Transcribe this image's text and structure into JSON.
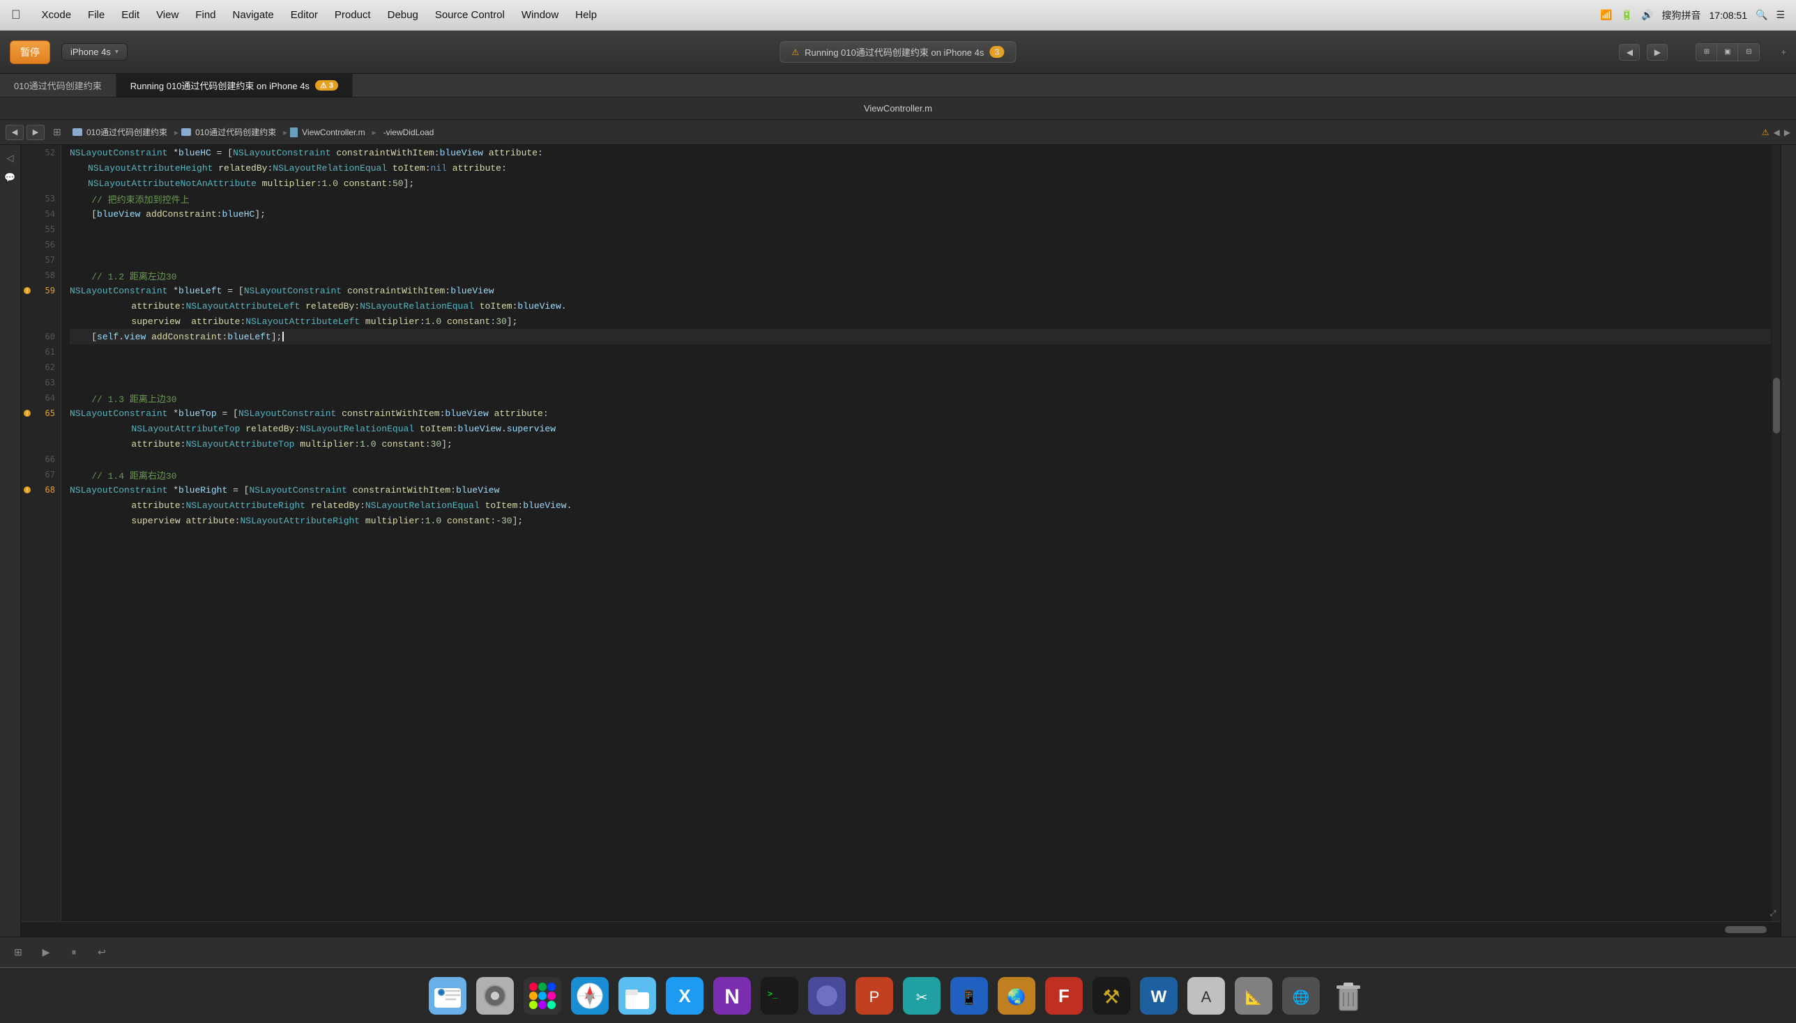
{
  "menubar": {
    "apple": "🍎",
    "items": [
      "Xcode",
      "File",
      "Edit",
      "View",
      "Find",
      "Navigate",
      "Editor",
      "Product",
      "Debug",
      "Source Control",
      "Window",
      "Help"
    ],
    "right_items": [
      "🔍",
      "📋"
    ],
    "input_method": "搜狗拼音",
    "time": "17:08:51"
  },
  "toolbar": {
    "stop_label": "暂停",
    "device_label": "iPhone 4s",
    "running_label": "Running 010通过代码创建约束 on iPhone 4s",
    "warnings_count": "3",
    "nav_icons": [
      "◀",
      "▶"
    ]
  },
  "tabs": [
    {
      "label": "010通过代码创建约束",
      "active": false
    },
    {
      "label": "Running 010通过代码创建约束 on iPhone 4s",
      "active": true,
      "warnings": "3"
    }
  ],
  "active_tab": "ViewController.m",
  "breadcrumb": {
    "items": [
      "010通过代码创建约束",
      "010通过代码创建约束",
      "ViewController.m",
      "-viewDidLoad"
    ]
  },
  "code": {
    "lines": [
      {
        "num": 52,
        "tokens": [
          {
            "t": "NSLayoutConstraint",
            "c": "oc-cls"
          },
          {
            "t": " *",
            "c": "op"
          },
          {
            "t": "blueHC",
            "c": "var"
          },
          {
            "t": " = [",
            "c": "op"
          },
          {
            "t": "NSLayoutConstraint",
            "c": "oc-cls"
          },
          {
            "t": " ",
            "c": ""
          },
          {
            "t": "constraintWithItem",
            "c": "oc-method"
          },
          {
            "t": ":",
            "c": "op"
          },
          {
            "t": "blueView",
            "c": "var"
          },
          {
            "t": " ",
            "c": ""
          },
          {
            "t": "attribute",
            "c": "oc-method"
          },
          {
            "t": ":",
            "c": "op"
          }
        ],
        "cont": true
      },
      {
        "num": null,
        "cont_text": "        NSLayoutAttributeHeight relatedBy:NSLayoutRelationEqual toItem:nil attribute:"
      },
      {
        "num": null,
        "cont_text": "        NSLayoutAttributeNotAnAttribute multiplier:1.0 constant:50];"
      },
      {
        "num": 53,
        "comment": "// 把约束添加到控件上"
      },
      {
        "num": 54,
        "text": "    [blueView addConstraint:blueHC];"
      },
      {
        "num": 55,
        "empty": true
      },
      {
        "num": 56,
        "empty": true
      },
      {
        "num": 57,
        "empty": true
      },
      {
        "num": 58,
        "comment": "// 1.2 距离左边30"
      },
      {
        "num": 59,
        "warning": true,
        "text_parts": [
          {
            "t": "NSLayoutConstraint",
            "c": "oc-cls"
          },
          {
            "t": " *",
            "c": "op"
          },
          {
            "t": "blueLeft",
            "c": "var"
          },
          {
            "t": " = [",
            "c": "op"
          },
          {
            "t": "NSLayoutConstraint",
            "c": "oc-cls"
          },
          {
            "t": " ",
            "c": ""
          },
          {
            "t": "constraintWithItem",
            "c": "oc-method"
          },
          {
            "t": ":",
            "c": "op"
          },
          {
            "t": "blueView",
            "c": "var"
          }
        ],
        "cont": true
      },
      {
        "num": null,
        "cont_text": "        attribute:NSLayoutAttributeLeft relatedBy:NSLayoutRelationEqual toItem:blueView."
      },
      {
        "num": null,
        "cont_text": "        superview  attribute:NSLayoutAttributeLeft multiplier:1.0 constant:30];"
      },
      {
        "num": 60,
        "text": "    [self.view addConstraint:blueLeft];",
        "cursor": true
      },
      {
        "num": 61,
        "empty": true
      },
      {
        "num": 62,
        "empty": true
      },
      {
        "num": 63,
        "empty": true
      },
      {
        "num": 64,
        "comment": "// 1.3 距离上边30"
      },
      {
        "num": 65,
        "warning": true,
        "text_parts": [
          {
            "t": "NSLayoutConstraint",
            "c": "oc-cls"
          },
          {
            "t": " *",
            "c": "var"
          },
          {
            "t": "blueTop",
            "c": "var"
          },
          {
            "t": " = [",
            "c": "op"
          },
          {
            "t": "NSLayoutConstraint",
            "c": "oc-cls"
          },
          {
            "t": " ",
            "c": ""
          },
          {
            "t": "constraintWithItem",
            "c": "oc-method"
          },
          {
            "t": ":",
            "c": "op"
          },
          {
            "t": "blueView",
            "c": "var"
          },
          {
            "t": " attribute:",
            "c": "op"
          }
        ],
        "cont": true
      },
      {
        "num": null,
        "cont_text": "        NSLayoutAttributeTop relatedBy:NSLayoutRelationEqual toItem:blueView.superview"
      },
      {
        "num": null,
        "cont_text": "        attribute:NSLayoutAttributeTop multiplier:1.0 constant:30];"
      },
      {
        "num": 66,
        "empty": true
      },
      {
        "num": 67,
        "comment": "// 1.4 距离右边30"
      },
      {
        "num": 68,
        "warning": true,
        "text_parts": [
          {
            "t": "NSLayoutConstraint",
            "c": "oc-cls"
          },
          {
            "t": " *",
            "c": "var"
          },
          {
            "t": "blueRight",
            "c": "var"
          },
          {
            "t": " = [",
            "c": "op"
          },
          {
            "t": "NSLayoutConstraint",
            "c": "oc-cls"
          },
          {
            "t": " ",
            "c": ""
          },
          {
            "t": "constraintWithItem",
            "c": "oc-method"
          },
          {
            "t": ":",
            "c": "op"
          },
          {
            "t": "blueView",
            "c": "var"
          }
        ],
        "cont": true
      },
      {
        "num": null,
        "cont_text": "        attribute:NSLayoutAttributeRight relatedBy:NSLayoutRelationEqual toItem:blueView."
      },
      {
        "num": null,
        "cont_text": "        superview attribute:NSLayoutAttributeRight multiplier:1.0 constant:-30];"
      }
    ]
  },
  "dock": {
    "items": [
      {
        "icon": "🔍",
        "name": "finder"
      },
      {
        "icon": "⚙️",
        "name": "system-preferences"
      },
      {
        "icon": "🚀",
        "name": "launchpad"
      },
      {
        "icon": "🌐",
        "name": "safari"
      },
      {
        "icon": "📁",
        "name": "files"
      },
      {
        "icon": "✖️",
        "name": "xcode-icon"
      },
      {
        "icon": "📓",
        "name": "onenote"
      },
      {
        "icon": "🖥️",
        "name": "terminal"
      },
      {
        "icon": "🔖",
        "name": "bookmark"
      },
      {
        "icon": "🎯",
        "name": "app1"
      },
      {
        "icon": "🔧",
        "name": "xcode-tools"
      },
      {
        "icon": "❓",
        "name": "help"
      },
      {
        "icon": "🔴",
        "name": "filezilla"
      },
      {
        "icon": "⚒️",
        "name": "tools"
      },
      {
        "icon": "📝",
        "name": "word"
      },
      {
        "icon": "🔤",
        "name": "font"
      },
      {
        "icon": "📐",
        "name": "measure"
      },
      {
        "icon": "🌐",
        "name": "browser"
      },
      {
        "icon": "🗑️",
        "name": "trash"
      }
    ]
  },
  "bottom_bar": {
    "icons": [
      "⊞",
      "▶",
      "⏸",
      "↩"
    ]
  }
}
